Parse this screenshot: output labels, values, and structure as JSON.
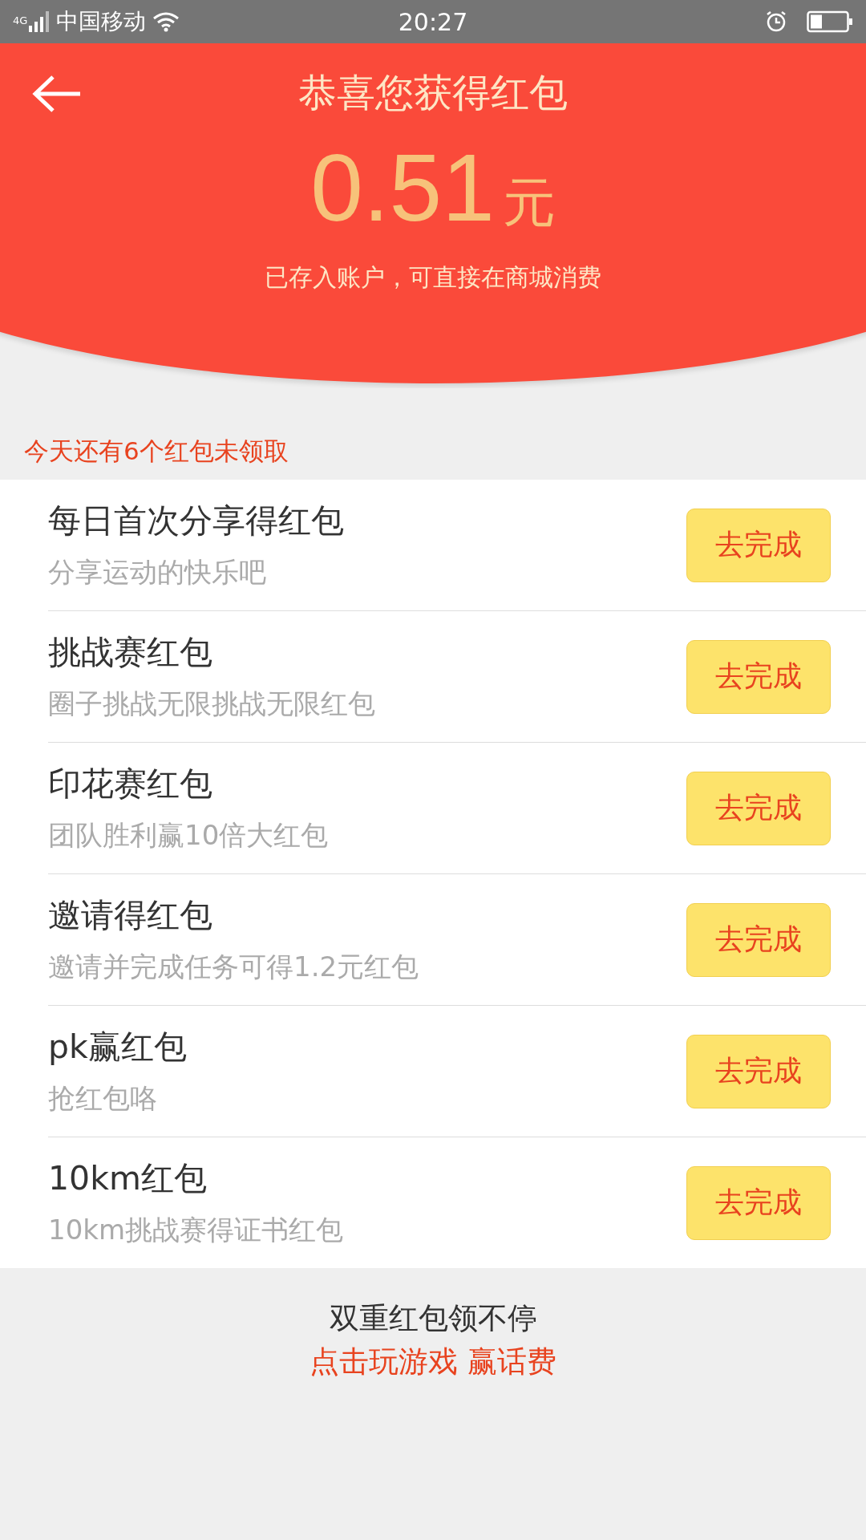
{
  "status_bar": {
    "network": "4G",
    "carrier": "中国移动",
    "time": "20:27"
  },
  "header": {
    "title": "恭喜您获得红包",
    "amount": "0.51",
    "unit": "元",
    "note": "已存入账户，可直接在商城消费"
  },
  "remaining": "今天还有6个红包未领取",
  "tasks": [
    {
      "title": "每日首次分享得红包",
      "subtitle": "分享运动的快乐吧",
      "action": "去完成"
    },
    {
      "title": "挑战赛红包",
      "subtitle": "圈子挑战无限挑战无限红包",
      "action": "去完成"
    },
    {
      "title": "印花赛红包",
      "subtitle": "团队胜利赢10倍大红包",
      "action": "去完成"
    },
    {
      "title": "邀请得红包",
      "subtitle": "邀请并完成任务可得1.2元红包",
      "action": "去完成"
    },
    {
      "title": "pk赢红包",
      "subtitle": "抢红包咯",
      "action": "去完成"
    },
    {
      "title": "10km红包",
      "subtitle": "10km挑战赛得证书红包",
      "action": "去完成"
    }
  ],
  "footer": {
    "line": "双重红包领不停",
    "link": "点击玩游戏 赢话费"
  }
}
